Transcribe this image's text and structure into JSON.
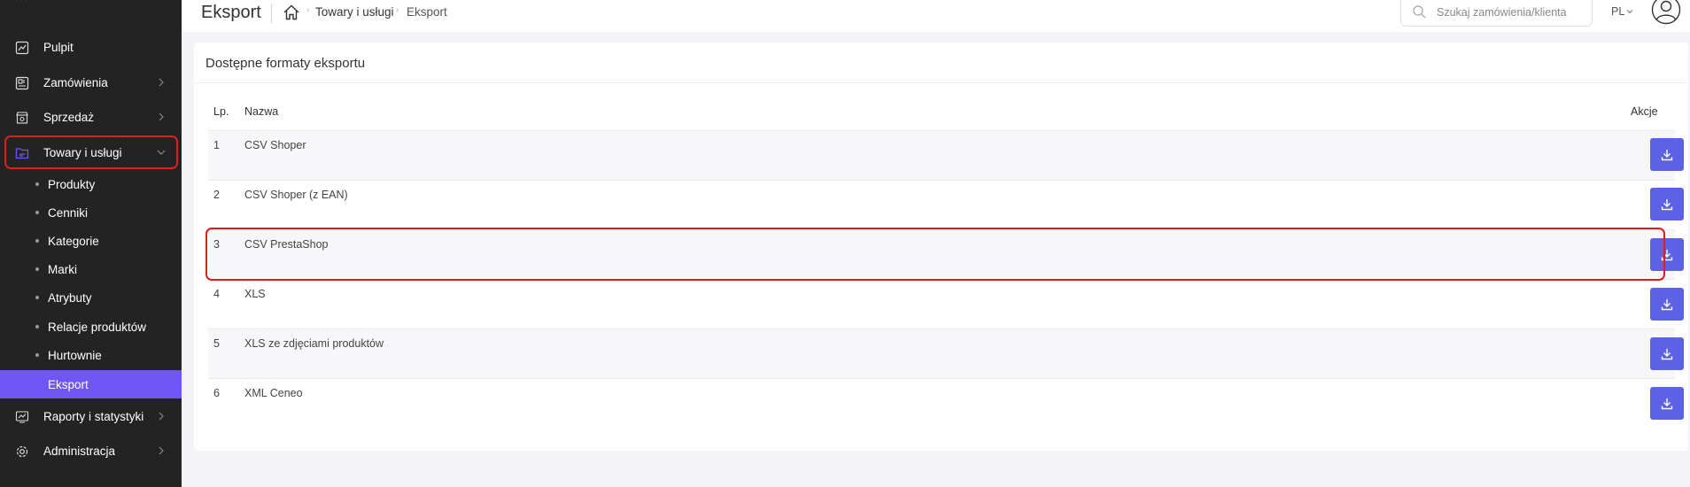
{
  "sidebar": {
    "items": [
      {
        "label": "Pulpit",
        "icon": "chart-line-icon",
        "has_chevron": false
      },
      {
        "label": "Zamówienia",
        "icon": "orders-icon",
        "has_chevron": true
      },
      {
        "label": "Sprzedaż",
        "icon": "shop-icon",
        "has_chevron": true
      },
      {
        "label": "Towary i usługi",
        "icon": "folder-icon",
        "has_chevron": true,
        "expanded": true
      },
      {
        "label": "Raporty i statystyki",
        "icon": "report-icon",
        "has_chevron": true
      },
      {
        "label": "Administracja",
        "icon": "gear-icon",
        "has_chevron": true
      }
    ],
    "submenu": [
      {
        "label": "Produkty"
      },
      {
        "label": "Cenniki"
      },
      {
        "label": "Kategorie"
      },
      {
        "label": "Marki"
      },
      {
        "label": "Atrybuty"
      },
      {
        "label": "Relacje produktów"
      },
      {
        "label": "Hurtownie"
      },
      {
        "label": "Eksport",
        "active": true
      }
    ]
  },
  "header": {
    "title": "Eksport",
    "breadcrumb": [
      "Towary i usługi",
      "Eksport"
    ],
    "search_placeholder": "Szukaj zamówienia/klienta",
    "language": "PL"
  },
  "card": {
    "title": "Dostępne formaty eksportu",
    "columns": {
      "lp": "Lp.",
      "name": "Nazwa",
      "actions": "Akcje"
    },
    "rows": [
      {
        "lp": "1",
        "name": "CSV Shoper"
      },
      {
        "lp": "2",
        "name": "CSV Shoper (z EAN)"
      },
      {
        "lp": "3",
        "name": "CSV PrestaShop"
      },
      {
        "lp": "4",
        "name": "XLS"
      },
      {
        "lp": "5",
        "name": "XLS ze zdjęciami produktów"
      },
      {
        "lp": "6",
        "name": "XML Ceneo"
      }
    ]
  },
  "colors": {
    "sidebar_bg": "#232323",
    "accent": "#6f56f5",
    "button": "#5b62e3",
    "highlight_frame": "#e31b1b"
  }
}
